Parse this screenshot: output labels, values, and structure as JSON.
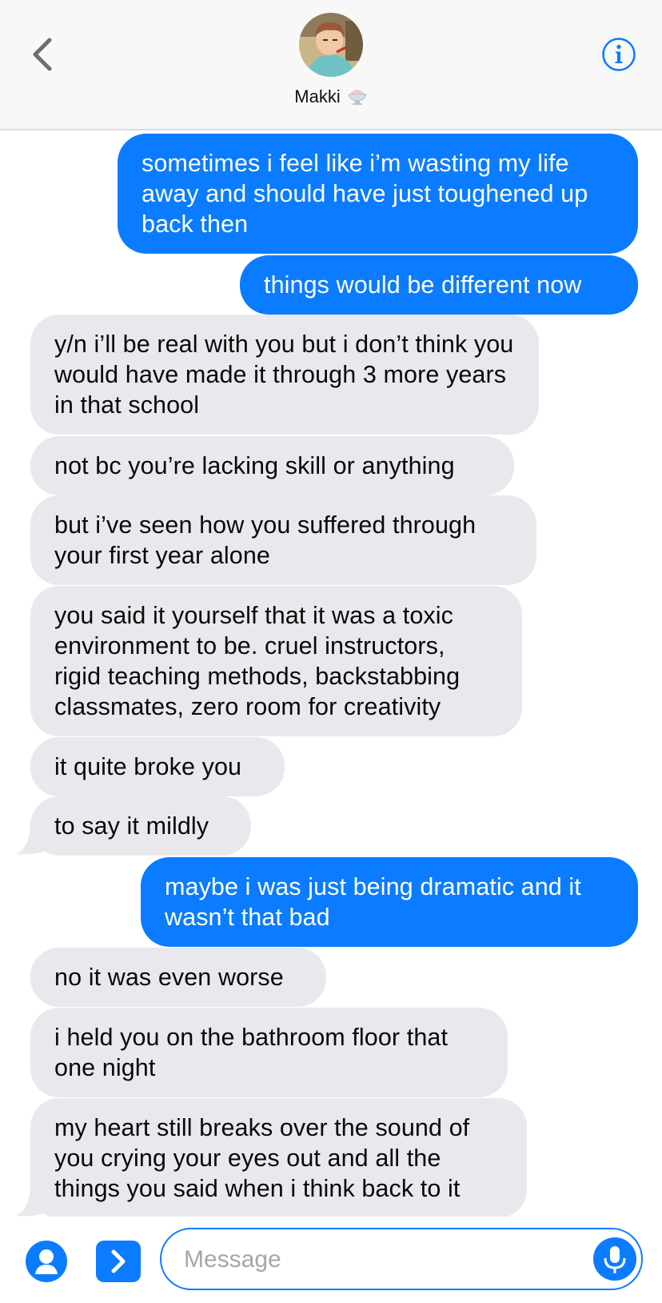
{
  "header": {
    "contact_name": "Makki",
    "name_emoji": "shaved-ice-icon",
    "back_icon": "chevron-left-icon",
    "info_icon": "info-icon",
    "accent_color": "#0b7cff"
  },
  "messages": [
    {
      "from": "me",
      "text": "sometimes i feel like i’m wasting my life away and should have just toughened up back then"
    },
    {
      "from": "me",
      "text": "things would be different now"
    },
    {
      "from": "them",
      "text": "y/n i’ll be real with you but i don’t think you would have made it through 3 more years in that school"
    },
    {
      "from": "them",
      "text": "not bc you’re lacking skill or anything"
    },
    {
      "from": "them",
      "text": "but i’ve seen how you suffered through your first year alone"
    },
    {
      "from": "them",
      "text": "you said it yourself that it was a toxic environment to be. cruel instructors, rigid teaching methods, backstabbing classmates, zero room for creativity"
    },
    {
      "from": "them",
      "text": "it quite broke you"
    },
    {
      "from": "them",
      "text": "to say it mildly"
    },
    {
      "from": "me",
      "text": "maybe i was just being dramatic and it wasn’t that bad"
    },
    {
      "from": "them",
      "text": "no it was even worse"
    },
    {
      "from": "them",
      "text": "i held you on the bathroom floor that one night"
    },
    {
      "from": "them",
      "text": "my heart still breaks over the sound of you crying your eyes out and all the things you said when i think back to it"
    }
  ],
  "composer": {
    "placeholder": "Message",
    "contacts_icon": "person-icon",
    "apps_icon": "chevron-right-icon",
    "mic_icon": "microphone-icon"
  },
  "colors": {
    "sent_bubble": "#0b7cff",
    "received_bubble": "#e9e8ed",
    "header_bg": "#f8f8f8"
  }
}
